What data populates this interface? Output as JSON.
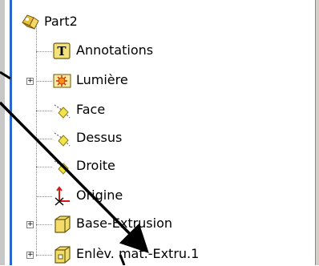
{
  "tree": {
    "root": {
      "label": "Part2",
      "icon": "part-icon"
    },
    "items": [
      {
        "label": "Annotations",
        "icon": "annotations-icon",
        "expandable": false
      },
      {
        "label": "Lumière",
        "icon": "lighting-icon",
        "expandable": true
      },
      {
        "label": "Face",
        "icon": "plane-icon",
        "expandable": false
      },
      {
        "label": "Dessus",
        "icon": "plane-icon",
        "expandable": false
      },
      {
        "label": "Droite",
        "icon": "plane-icon",
        "expandable": false
      },
      {
        "label": "Origine",
        "icon": "origin-icon",
        "expandable": false
      },
      {
        "label": "Base-Extrusion",
        "icon": "extrusion-icon",
        "expandable": true
      },
      {
        "label": "Enlèv. mat.-Extru.1",
        "icon": "cut-extrusion-icon",
        "expandable": true
      }
    ],
    "expander_symbol": "+"
  },
  "colors": {
    "selection_border": "#2b66cc",
    "plane_yellow": "#f2e24b",
    "origin_red": "#d11b1b"
  }
}
